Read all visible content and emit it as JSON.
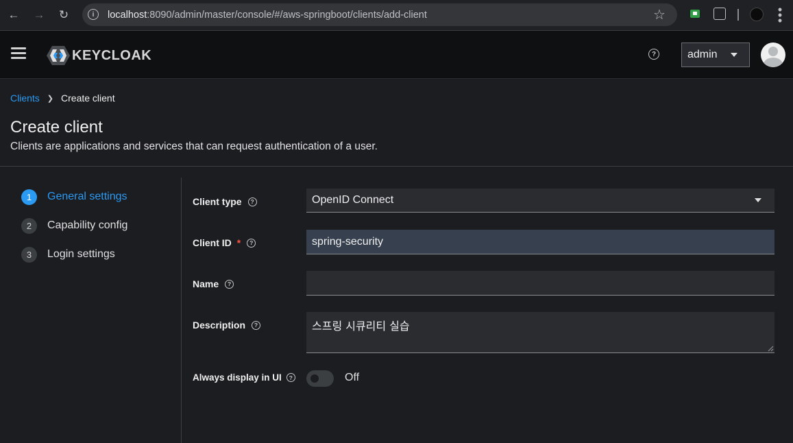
{
  "browser": {
    "url_host": "localhost",
    "url_rest": ":8090/admin/master/console/#/aws-springboot/clients/add-client"
  },
  "header": {
    "logo_text": "KEYCLOAK",
    "user_name": "admin"
  },
  "breadcrumb": {
    "parent": "Clients",
    "current": "Create client"
  },
  "page": {
    "title": "Create client",
    "description": "Clients are applications and services that can request authentication of a user."
  },
  "wizard": {
    "steps": [
      {
        "number": "1",
        "label": "General settings",
        "active": true
      },
      {
        "number": "2",
        "label": "Capability config",
        "active": false
      },
      {
        "number": "3",
        "label": "Login settings",
        "active": false
      }
    ]
  },
  "form": {
    "client_type": {
      "label": "Client type",
      "value": "OpenID Connect"
    },
    "client_id": {
      "label": "Client ID",
      "required_mark": "*",
      "value": "spring-security"
    },
    "name": {
      "label": "Name",
      "value": ""
    },
    "description": {
      "label": "Description",
      "value": "스프링 시큐리티 실습"
    },
    "always_display": {
      "label": "Always display in UI",
      "state": "Off"
    }
  },
  "colors": {
    "accent": "#2b9af3",
    "required": "#fe5142",
    "background": "#1b1d21",
    "header": "#0f1012"
  }
}
